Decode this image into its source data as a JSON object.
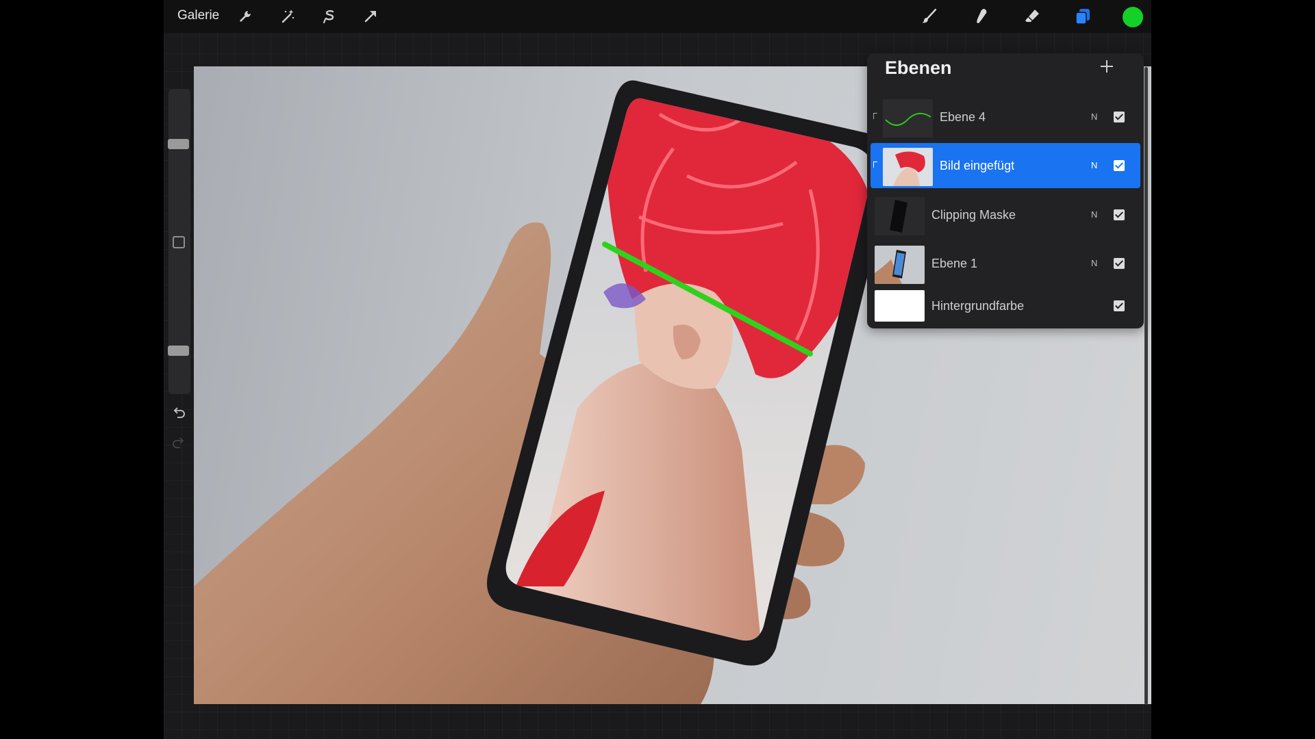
{
  "toolbar": {
    "gallery_label": "Galerie",
    "left_tools": [
      "wrench-icon",
      "magic-wand-icon",
      "selection-icon",
      "transform-arrow-icon"
    ],
    "right_tools": [
      "brush-icon",
      "smudge-icon",
      "eraser-icon",
      "layers-icon"
    ],
    "active_color": "#13d126"
  },
  "sidebar": {
    "brush_size_level": 0.65,
    "opacity_level": 0.25,
    "undo_icon": "undo-icon",
    "redo_icon": "redo-icon"
  },
  "layers_panel": {
    "title": "Ebenen",
    "add_icon": "plus-icon",
    "layers": [
      {
        "name": "Ebene 4",
        "mode": "N",
        "visible": true,
        "clipped": true,
        "active": false
      },
      {
        "name": "Bild eingefügt",
        "mode": "N",
        "visible": true,
        "clipped": true,
        "active": true
      },
      {
        "name": "Clipping Maske",
        "mode": "N",
        "visible": true,
        "clipped": false,
        "active": false
      },
      {
        "name": "Ebene 1",
        "mode": "N",
        "visible": true,
        "clipped": false,
        "active": false
      },
      {
        "name": "Hintergrundfarbe",
        "mode": "",
        "visible": true,
        "clipped": false,
        "active": false
      }
    ]
  },
  "colors": {
    "accent_selection": "#1a73f0",
    "toolbar_bg": "#111112",
    "panel_bg": "#222224"
  }
}
